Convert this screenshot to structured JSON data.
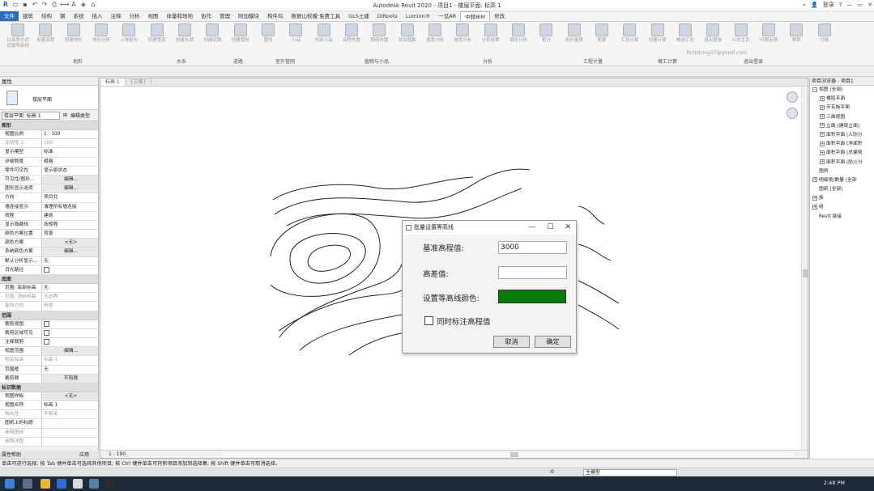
{
  "window": {
    "title": "Autodesk Revit 2020 - 项目1 - 楼层平面: 标高 1",
    "user": "登录",
    "search_icon": "search-icon"
  },
  "menu": [
    "文件",
    "建筑",
    "结构",
    "钢",
    "系统",
    "插入",
    "注释",
    "分析",
    "视图",
    "体量和场地",
    "协作",
    "管理",
    "附加模块",
    "构件坞",
    "数据山校模·免费工具",
    "GLS土建",
    "DiRoots",
    "Lumion®",
    "一见AR",
    "中赫BIM",
    "修改"
  ],
  "menu_active_index": 19,
  "ribbon": {
    "buttons": [
      "以高差方式设置等高线",
      "批量高程",
      "创建地形",
      "地形分析",
      "上坡箭头",
      "创建管道",
      "创建水源",
      "创建道路",
      "创建管网",
      "管线",
      "小品",
      "内部小品",
      "高程布置",
      "图纸布置",
      "添加图集",
      "坡度分析",
      "坡度分析",
      "分析结果",
      "填挖分析",
      "粗分",
      "初步量算",
      "粗算",
      "汇总计算",
      "创建计算",
      "概述汇总",
      "退出登录",
      "公司主页",
      "问题反馈",
      "帮助",
      "付费"
    ],
    "groups": [
      "地形",
      "水系",
      "道路",
      "室外管网",
      "植物与小品",
      "分析",
      "工程计量",
      "概汇计算",
      "退出登录"
    ],
    "login_email": "firststring57@gmail.com"
  },
  "properties": {
    "title": "属性",
    "type_name": "楼层平面",
    "selector": "楼层平面: 标高 1",
    "edit_type": "编辑类型",
    "rows": [
      {
        "cat": "图形"
      },
      {
        "k": "视图比例",
        "v": "1 : 100"
      },
      {
        "k": "比例值 1:",
        "v": "100",
        "dis": true
      },
      {
        "k": "显示模型",
        "v": "标准"
      },
      {
        "k": "详细程度",
        "v": "粗略"
      },
      {
        "k": "零件可见性",
        "v": "显示原状态"
      },
      {
        "k": "可见性/图形...",
        "v": "编辑...",
        "btn": true
      },
      {
        "k": "图形显示选项",
        "v": "编辑...",
        "btn": true
      },
      {
        "k": "方向",
        "v": "项目北"
      },
      {
        "k": "墙连接显示",
        "v": "清理所有墙连接"
      },
      {
        "k": "规程",
        "v": "建筑"
      },
      {
        "k": "显示隐藏线",
        "v": "按规程"
      },
      {
        "k": "颜色方案位置",
        "v": "背景"
      },
      {
        "k": "颜色方案",
        "v": "<无>",
        "btn": true
      },
      {
        "k": "系统颜色方案",
        "v": "编辑...",
        "btn": true
      },
      {
        "k": "默认分析显示...",
        "v": "无"
      },
      {
        "k": "日光路径",
        "v": "",
        "chk": true
      },
      {
        "cat": "底图"
      },
      {
        "k": "范围: 底部标高",
        "v": "无"
      },
      {
        "k": "范围: 顶部标高",
        "v": "无边界",
        "dis": true
      },
      {
        "k": "基线方向",
        "v": "俯视",
        "dis": true
      },
      {
        "cat": "范围"
      },
      {
        "k": "裁剪视图",
        "v": "",
        "chk": true
      },
      {
        "k": "裁剪区域可见",
        "v": "",
        "chk": true
      },
      {
        "k": "注释裁剪",
        "v": "",
        "chk": true
      },
      {
        "k": "视图范围",
        "v": "编辑...",
        "btn": true
      },
      {
        "k": "相关标高",
        "v": "标高 1",
        "dis": true
      },
      {
        "k": "范围框",
        "v": "无"
      },
      {
        "k": "截剪裁",
        "v": "不剪裁",
        "btn": true
      },
      {
        "cat": "标识数据"
      },
      {
        "k": "视图样板",
        "v": "<无>",
        "btn": true
      },
      {
        "k": "视图名称",
        "v": "标高 1"
      },
      {
        "k": "相关性",
        "v": "不相关",
        "dis": true
      },
      {
        "k": "图纸上的标题",
        "v": ""
      },
      {
        "k": "参照图纸",
        "v": "",
        "dis": true
      },
      {
        "k": "参照详图",
        "v": "",
        "dis": true
      }
    ],
    "help": "属性帮助",
    "apply": "应用"
  },
  "canvas": {
    "tabs": [
      "标高 1",
      "{三维}"
    ],
    "scale": "1 : 100"
  },
  "browser": {
    "title": "项目浏览器 - 项目1",
    "nodes": [
      {
        "label": "视图 (全部)",
        "depth": 0,
        "pm": "-"
      },
      {
        "label": "楼层平面",
        "depth": 1,
        "pm": "+"
      },
      {
        "label": "天花板平面",
        "depth": 1,
        "pm": "+"
      },
      {
        "label": "三维视图",
        "depth": 1,
        "pm": "+"
      },
      {
        "label": "立面 (建筑立面)",
        "depth": 1,
        "pm": "+"
      },
      {
        "label": "面积平面 (人防分",
        "depth": 1,
        "pm": "+"
      },
      {
        "label": "面积平面 (净面积",
        "depth": 1,
        "pm": "+"
      },
      {
        "label": "面积平面 (总建筑",
        "depth": 1,
        "pm": "+"
      },
      {
        "label": "面积平面 (防火分",
        "depth": 1,
        "pm": "+"
      },
      {
        "label": "图例",
        "depth": 0,
        "pm": ""
      },
      {
        "label": "明细表/数量 (全部",
        "depth": 0,
        "pm": "+"
      },
      {
        "label": "图纸 (全部)",
        "depth": 0,
        "pm": ""
      },
      {
        "label": "族",
        "depth": 0,
        "pm": "+"
      },
      {
        "label": "组",
        "depth": 0,
        "pm": "+"
      },
      {
        "label": "Revit 链接",
        "depth": 0,
        "pm": ""
      }
    ]
  },
  "dialog": {
    "title": "批量设置等高线",
    "base_label": "基准高程值:",
    "base_value": "3000",
    "diff_label": "高差值:",
    "diff_value": "",
    "color_label": "设置等高线颜色:",
    "color": "#0a7a0a",
    "check_label": "同时标注高程值",
    "cancel": "取消",
    "ok": "确定"
  },
  "status": {
    "text": "单击可进行选择; 按 Tab 键并单击可选择其他项目; 按 Ctrl 键并单击可将新项目添加到选择集; 按 Shift 键并单击可取消选择。",
    "model": "主模型",
    "zero": ":0"
  },
  "taskbar": {
    "time": "2:48 PM"
  }
}
